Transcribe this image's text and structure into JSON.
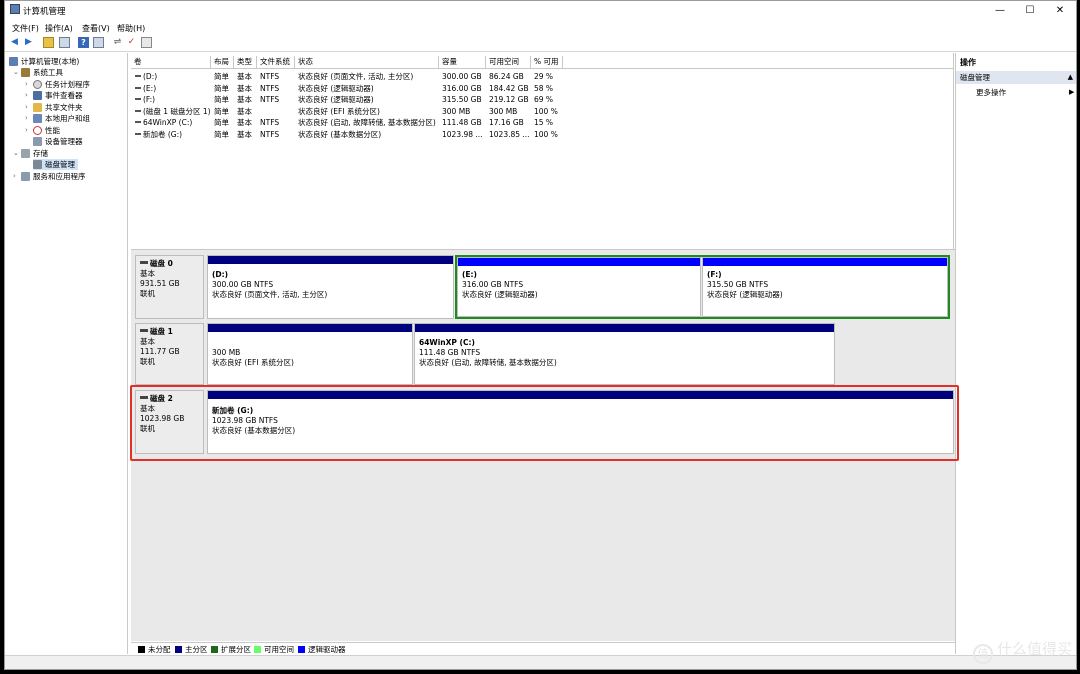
{
  "window": {
    "title": "计算机管理",
    "min": "—",
    "max": "☐",
    "close": "✕"
  },
  "menu": [
    "文件(F)",
    "操作(A)",
    "查看(V)",
    "帮助(H)"
  ],
  "tree": {
    "root": "计算机管理(本地)",
    "system_tools": "系统工具",
    "task_scheduler": "任务计划程序",
    "event_viewer": "事件查看器",
    "shared_folders": "共享文件夹",
    "local_users": "本地用户和组",
    "performance": "性能",
    "device_manager": "设备管理器",
    "storage": "存储",
    "disk_management": "磁盘管理",
    "services": "服务和应用程序"
  },
  "volumes": {
    "headers": [
      "卷",
      "布局",
      "类型",
      "文件系统",
      "状态",
      "容量",
      "可用空间",
      "% 可用"
    ],
    "rows": [
      [
        "(D:)",
        "简单",
        "基本",
        "NTFS",
        "状态良好 (页面文件, 活动, 主分区)",
        "300.00 GB",
        "86.24 GB",
        "29 %"
      ],
      [
        "(E:)",
        "简单",
        "基本",
        "NTFS",
        "状态良好 (逻辑驱动器)",
        "316.00 GB",
        "184.42 GB",
        "58 %"
      ],
      [
        "(F:)",
        "简单",
        "基本",
        "NTFS",
        "状态良好 (逻辑驱动器)",
        "315.50 GB",
        "219.12 GB",
        "69 %"
      ],
      [
        "(磁盘 1 磁盘分区 1)",
        "简单",
        "基本",
        "",
        "状态良好 (EFI 系统分区)",
        "300 MB",
        "300 MB",
        "100 %"
      ],
      [
        "64WinXP (C:)",
        "简单",
        "基本",
        "NTFS",
        "状态良好 (启动, 故障转储, 基本数据分区)",
        "111.48 GB",
        "17.16 GB",
        "15 %"
      ],
      [
        "新加卷 (G:)",
        "简单",
        "基本",
        "NTFS",
        "状态良好 (基本数据分区)",
        "1023.98 ...",
        "1023.85 ...",
        "100 %"
      ]
    ]
  },
  "disks": [
    {
      "name": "磁盘 0",
      "type": "基本",
      "size": "931.51 GB",
      "status": "联机",
      "parts": [
        {
          "label": "(D:)",
          "size": "300.00 GB NTFS",
          "status": "状态良好 (页面文件, 活动, 主分区)"
        },
        {
          "label": "(E:)",
          "size": "316.00 GB NTFS",
          "status": "状态良好 (逻辑驱动器)"
        },
        {
          "label": "(F:)",
          "size": "315.50 GB NTFS",
          "status": "状态良好 (逻辑驱动器)"
        }
      ]
    },
    {
      "name": "磁盘 1",
      "type": "基本",
      "size": "111.77 GB",
      "status": "联机",
      "parts": [
        {
          "label": "",
          "size": "300 MB",
          "status": "状态良好 (EFI 系统分区)"
        },
        {
          "label": "64WinXP  (C:)",
          "size": "111.48 GB NTFS",
          "status": "状态良好 (启动, 故障转储, 基本数据分区)"
        }
      ]
    },
    {
      "name": "磁盘 2",
      "type": "基本",
      "size": "1023.98 GB",
      "status": "联机",
      "parts": [
        {
          "label": "新加卷  (G:)",
          "size": "1023.98 GB NTFS",
          "status": "状态良好 (基本数据分区)"
        }
      ]
    }
  ],
  "legend": [
    "未分配",
    "主分区",
    "扩展分区",
    "可用空间",
    "逻辑驱动器"
  ],
  "legend_colors": [
    "#000000",
    "#000080",
    "#1a6a1a",
    "#66ff66",
    "#0000ff"
  ],
  "colors": {
    "primary": "#00007f",
    "logical": "#0000ff",
    "extended": "#1f8a1f",
    "highlight": "#e0302a"
  },
  "actions": {
    "title": "操作",
    "section": "磁盘管理",
    "more": "更多操作"
  },
  "watermark": {
    "icon": "值",
    "text": "什么值得买"
  }
}
